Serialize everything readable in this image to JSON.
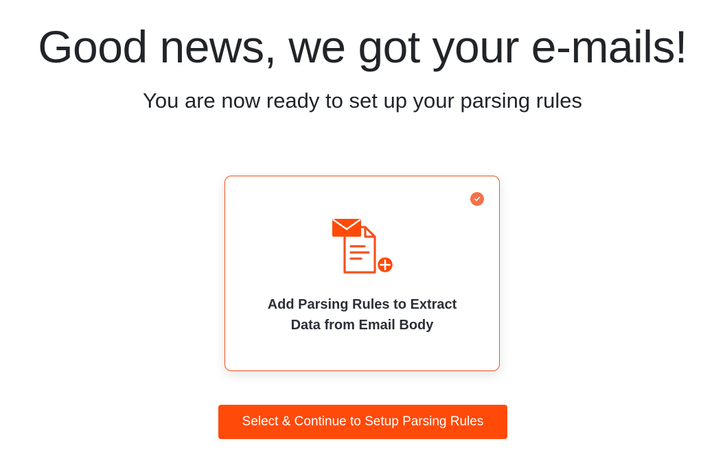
{
  "header": {
    "title": "Good news, we got your e-mails!",
    "subtitle": "You are now ready to set up your parsing rules"
  },
  "option_card": {
    "title": "Add Parsing Rules to Extract Data from Email Body",
    "selected": true,
    "icon": "email-document-add-icon",
    "check_icon": "check-circle-icon"
  },
  "actions": {
    "continue_label": "Select & Continue to Setup Parsing Rules"
  },
  "colors": {
    "accent": "#ff4a0a",
    "card_border": "#f4511e",
    "check_badge": "#f4724a",
    "text": "#212529"
  }
}
